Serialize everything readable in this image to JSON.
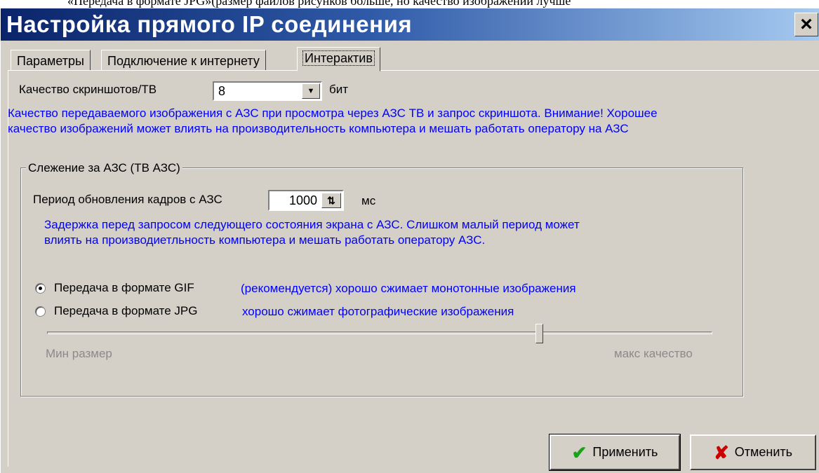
{
  "background_text": "«Передача в формате JPG»(размер файлов рисунков больше, но качество изображений лучше",
  "window": {
    "title": "Настройка прямого IP соединения",
    "close_symbol": "×"
  },
  "tabs": [
    {
      "label": "Параметры",
      "active": false
    },
    {
      "label": "Подключение к интернету",
      "active": false
    },
    {
      "label": "Интерактив",
      "active": true
    }
  ],
  "screenshot_quality": {
    "label": "Качество скриншотов/ТВ",
    "value": "8",
    "unit": "бит",
    "hint_line1": "Качество передаваемого изображения с АЗС при просмотра через АЗС ТВ и запрос скриншота. Внимание! Хорошее",
    "hint_line2": "качество изображений может влиять на производительность компьютера и мешать работать оператору на АЗС"
  },
  "monitoring": {
    "group_title": "Слежение за АЗС (ТВ АЗС)",
    "period_label": "Период обновления кадров с АЗС",
    "period_value": "1000",
    "period_unit": "мс",
    "period_hint_line1": "Задержка перед запросом следующего состояния экрана с АЗС. Слишком малый период может",
    "period_hint_line2": "влиять на производиетльность компьютера и мешать работать оператору АЗС.",
    "format_gif_label": "Передача в формате GIF",
    "format_gif_hint": "(рекомендуется) хорошо сжимает монотонные изображения",
    "format_jpg_label": "Передача в формате JPG",
    "format_jpg_hint": "хорошо сжимает фотографические изображения",
    "selected_format": "GIF",
    "slider_min_label": "Мин размер",
    "slider_max_label": "макс качество",
    "slider_level": 0.74,
    "slider_enabled": false
  },
  "buttons": {
    "apply_label": "Применить",
    "cancel_label": "Отменить"
  },
  "colors": {
    "hint_text": "#0000ff",
    "title_gradient_start": "#0a246a",
    "title_gradient_end": "#a6caf0",
    "apply_icon": "#1aa31a",
    "cancel_icon": "#cc0000"
  },
  "icons": {
    "apply": "checkmark-icon",
    "cancel": "x-icon"
  }
}
